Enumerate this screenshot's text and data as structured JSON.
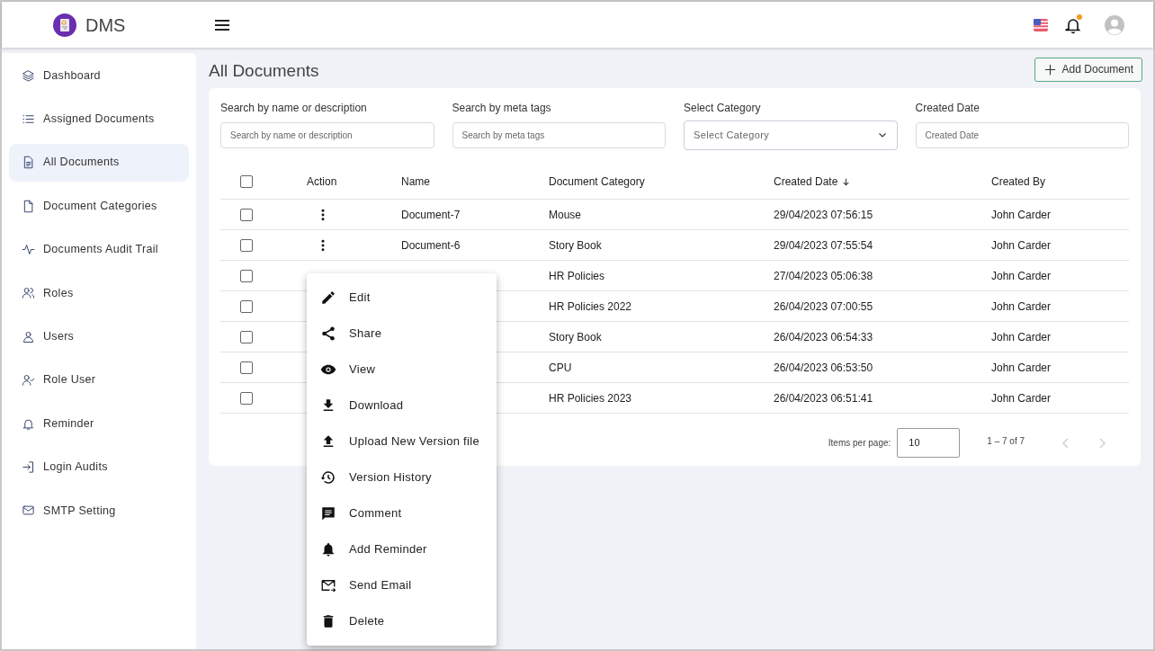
{
  "app": {
    "name": "DMS"
  },
  "header": {
    "notification_dot": true
  },
  "sidebar": {
    "items": [
      {
        "label": "Dashboard",
        "selected": false
      },
      {
        "label": "Assigned Documents",
        "selected": false
      },
      {
        "label": "All Documents",
        "selected": true
      },
      {
        "label": "Document Categories",
        "selected": false
      },
      {
        "label": "Documents Audit Trail",
        "selected": false
      },
      {
        "label": "Roles",
        "selected": false
      },
      {
        "label": "Users",
        "selected": false
      },
      {
        "label": "Role User",
        "selected": false
      },
      {
        "label": "Reminder",
        "selected": false
      },
      {
        "label": "Login Audits",
        "selected": false
      },
      {
        "label": "SMTP Setting",
        "selected": false
      }
    ]
  },
  "page": {
    "title": "All Documents",
    "add_button": "Add Document"
  },
  "filters": [
    {
      "kind": "text",
      "label": "Search by name or description",
      "placeholder": "Search by name or description"
    },
    {
      "kind": "text",
      "label": "Search by meta tags",
      "placeholder": "Search by meta tags"
    },
    {
      "kind": "select",
      "label": "Select Category",
      "placeholder": "Select Category"
    },
    {
      "kind": "text",
      "label": "Created Date",
      "placeholder": "Created Date"
    }
  ],
  "table": {
    "all_checked": false,
    "columns": [
      {
        "label": "Action",
        "sorted": false
      },
      {
        "label": "Name",
        "sorted": false
      },
      {
        "label": "Document Category",
        "sorted": false
      },
      {
        "label": "Created Date",
        "sorted": true
      },
      {
        "label": "Created By",
        "sorted": false
      }
    ],
    "rows": [
      {
        "checked": false,
        "name": "Document-7",
        "category": "Mouse",
        "created_date": "29/04/2023 07:56:15",
        "created_by": "John Carder"
      },
      {
        "checked": false,
        "name": "Document-6",
        "category": "Story Book",
        "created_date": "29/04/2023 07:55:54",
        "created_by": "John Carder"
      },
      {
        "checked": false,
        "category": "HR Policies",
        "created_date": "27/04/2023 05:06:38",
        "created_by": "John Carder"
      },
      {
        "checked": false,
        "category": "HR Policies 2022",
        "created_date": "26/04/2023 07:00:55",
        "created_by": "John Carder"
      },
      {
        "checked": false,
        "category": "Story Book",
        "created_date": "26/04/2023 06:54:33",
        "created_by": "John Carder"
      },
      {
        "checked": false,
        "category": "CPU",
        "created_date": "26/04/2023 06:53:50",
        "created_by": "John Carder"
      },
      {
        "checked": false,
        "category": "HR Policies 2023",
        "created_date": "26/04/2023 06:51:41",
        "created_by": "John Carder"
      }
    ]
  },
  "paginator": {
    "label": "Items per page:",
    "page_size": "10",
    "range": "1 – 7 of 7"
  },
  "context_menu": {
    "items": [
      {
        "label": "Edit"
      },
      {
        "label": "Share"
      },
      {
        "label": "View"
      },
      {
        "label": "Download"
      },
      {
        "label": "Upload New Version file"
      },
      {
        "label": "Version History"
      },
      {
        "label": "Comment"
      },
      {
        "label": "Add Reminder"
      },
      {
        "label": "Send Email"
      },
      {
        "label": "Delete"
      }
    ]
  }
}
